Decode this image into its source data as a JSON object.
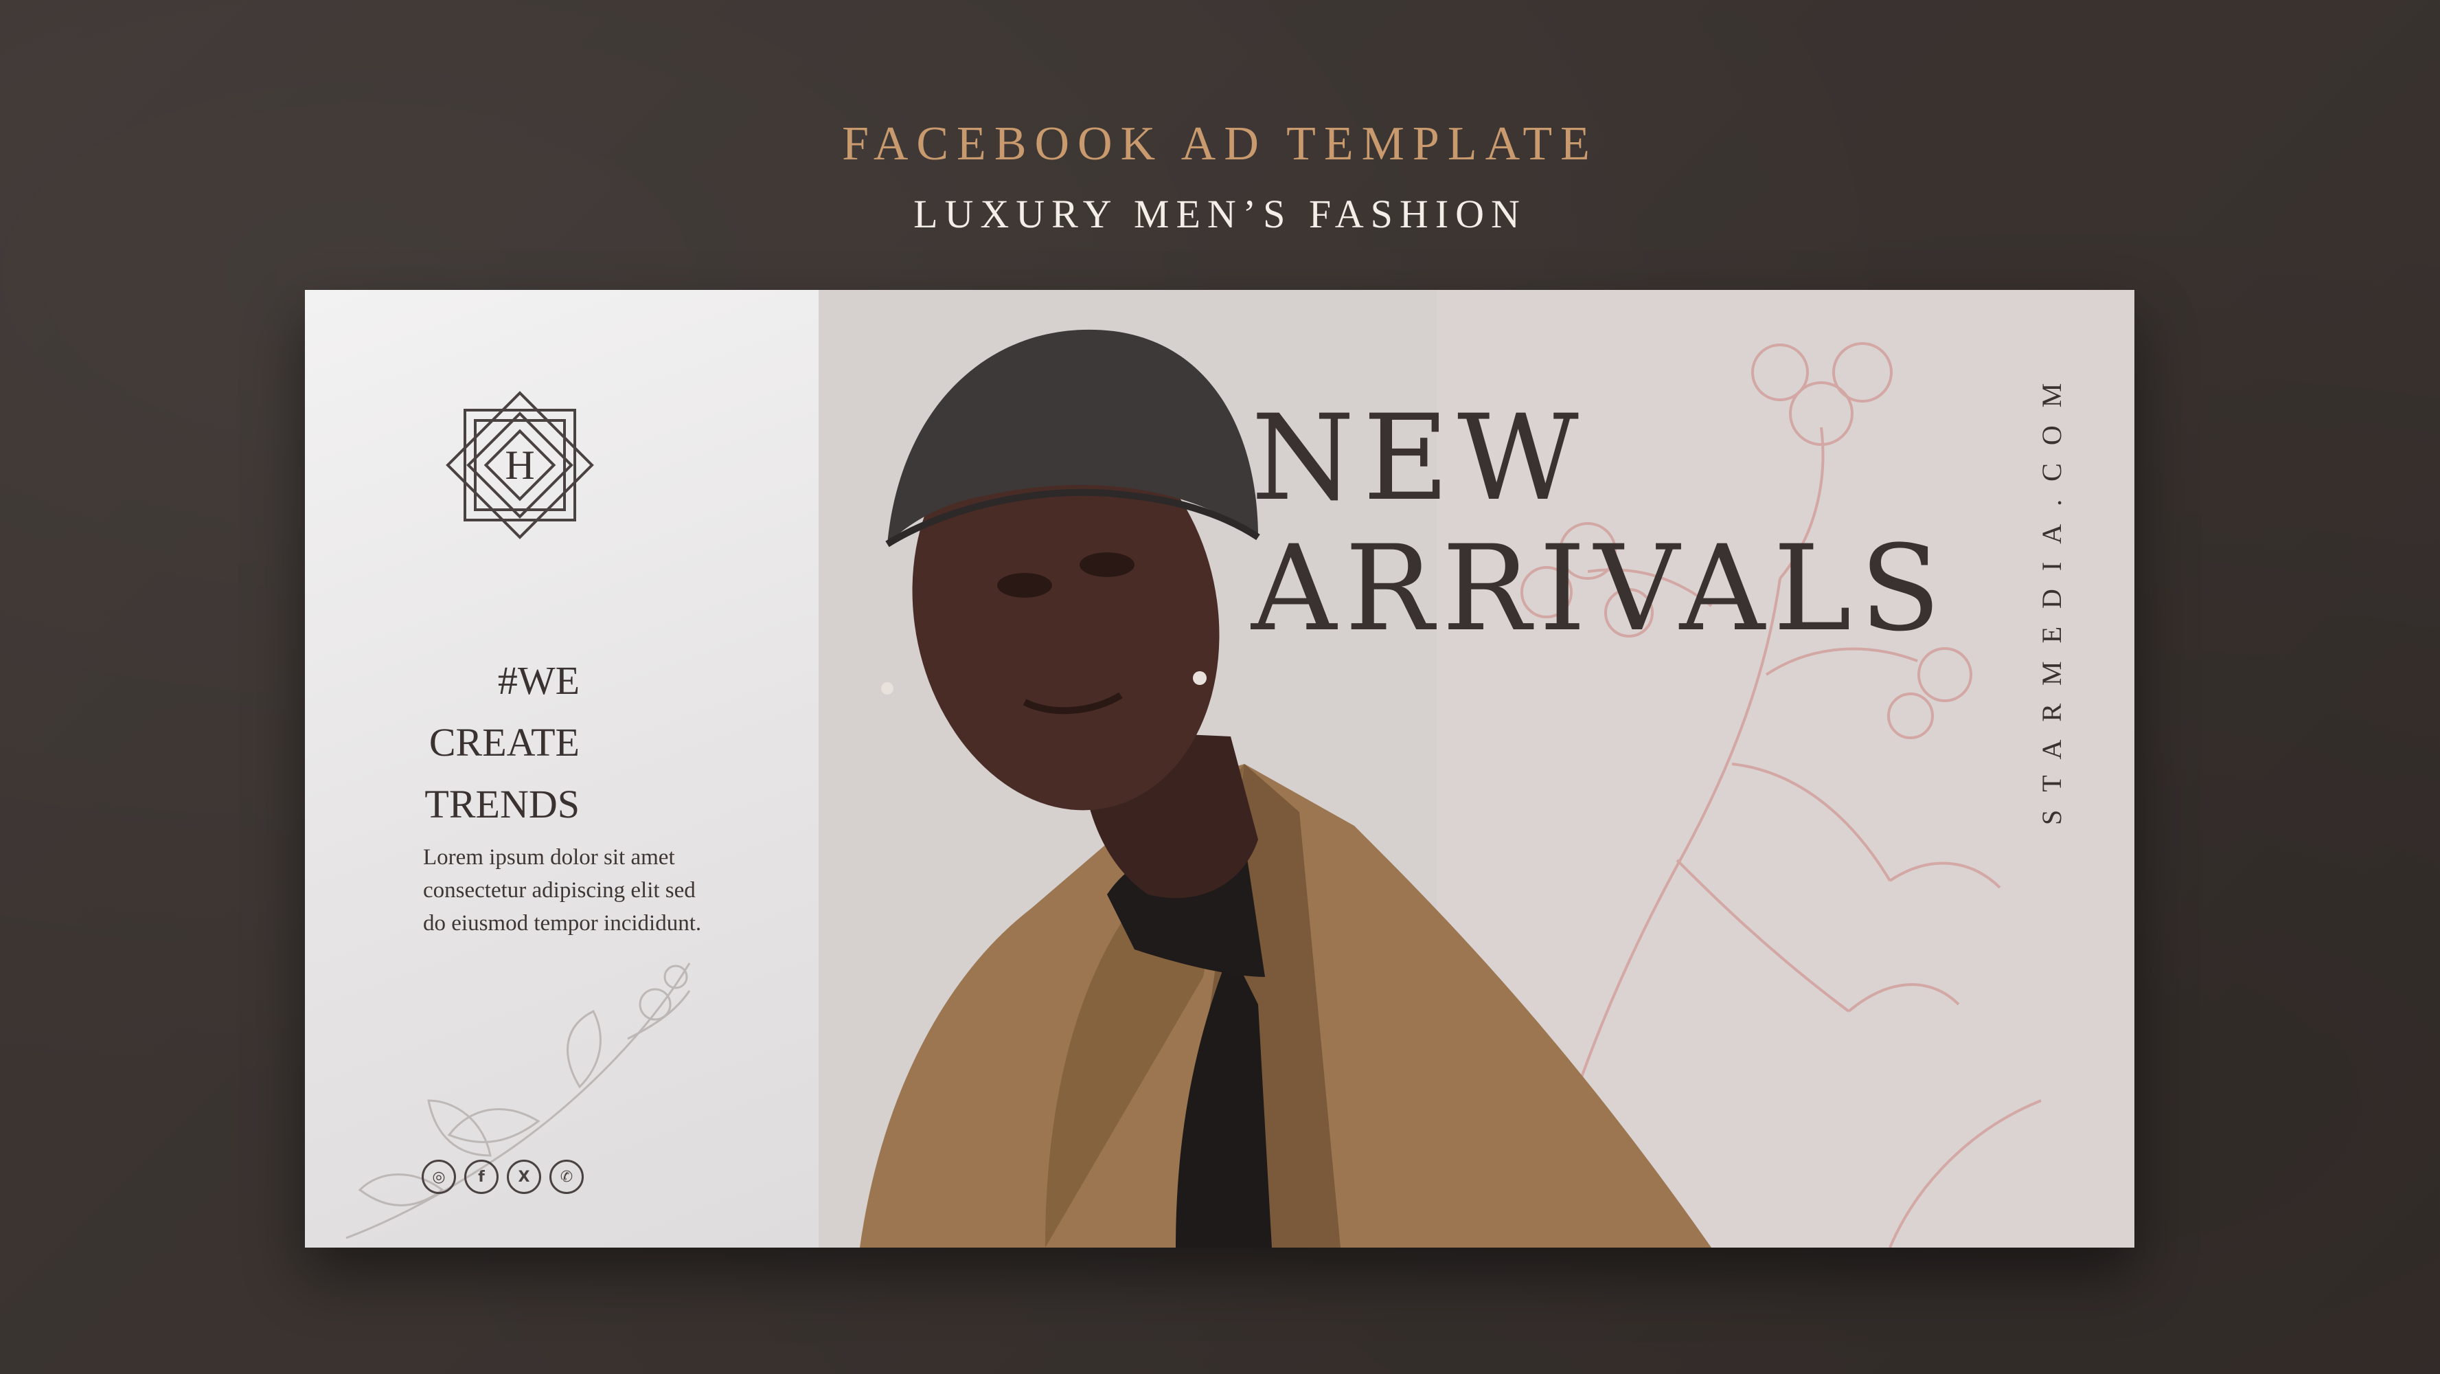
{
  "header": {
    "title": "FACEBOOK AD TEMPLATE",
    "subtitle": "LUXURY MEN’S FASHION"
  },
  "ad": {
    "logo_letter": "H",
    "hashtag_lines": [
      "#WE",
      "CREATE",
      "TRENDS"
    ],
    "body_text": "Lorem ipsum dolor sit amet consectetur adipiscing elit sed do eiusmod tempor incididunt.",
    "headline_lines": [
      "NEW",
      "ARRIVALS"
    ],
    "website": "STARMEDIA.COM",
    "social_icons": [
      {
        "name": "instagram-icon",
        "glyph": "◎"
      },
      {
        "name": "facebook-icon",
        "glyph": "f"
      },
      {
        "name": "x-icon",
        "glyph": "X"
      },
      {
        "name": "whatsapp-icon",
        "glyph": "✆"
      }
    ]
  },
  "colors": {
    "background": "#3a3431",
    "accent": "#c99a6e",
    "text_dark": "#3a3230",
    "jacket": "#9c7650"
  }
}
